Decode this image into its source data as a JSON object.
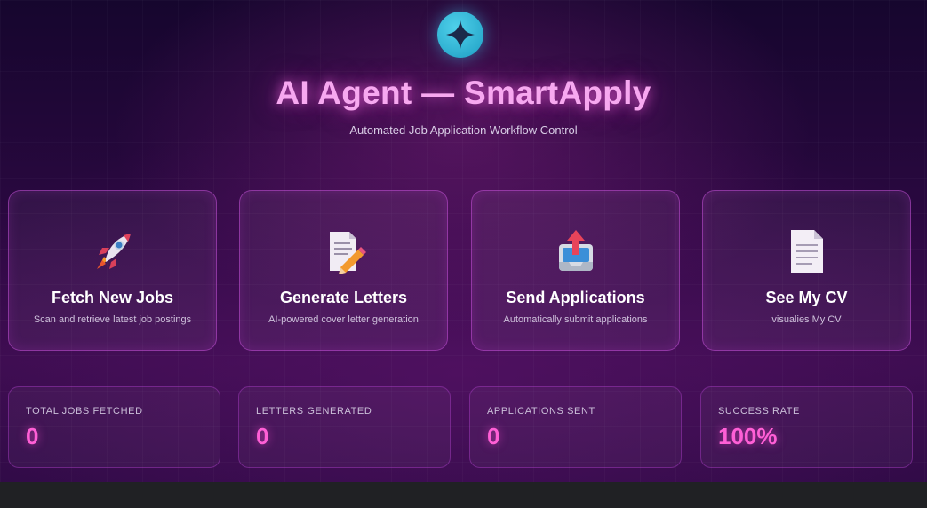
{
  "header": {
    "title": "AI Agent — SmartApply",
    "subtitle": "Automated Job Application Workflow Control",
    "logo_icon": "sparkle-star-icon"
  },
  "actions": [
    {
      "title": "Fetch New Jobs",
      "description": "Scan and retrieve latest job postings",
      "icon": "rocket-icon"
    },
    {
      "title": "Generate Letters",
      "description": "AI-powered cover letter generation",
      "icon": "document-pencil-icon"
    },
    {
      "title": "Send Applications",
      "description": "Automatically submit applications",
      "icon": "outbox-tray-icon"
    },
    {
      "title": "See My CV",
      "description": "visualies My CV",
      "icon": "page-icon"
    }
  ],
  "stats": [
    {
      "label": "TOTAL JOBS FETCHED",
      "value": "0"
    },
    {
      "label": "LETTERS GENERATED",
      "value": "0"
    },
    {
      "label": "APPLICATIONS SENT",
      "value": "0"
    },
    {
      "label": "SUCCESS RATE",
      "value": "100%"
    }
  ],
  "colors": {
    "title_glow": "#f7a8f0",
    "stat_value": "#ff5fd6",
    "logo": "#2fb8dc",
    "card_border": "#c850dc"
  }
}
